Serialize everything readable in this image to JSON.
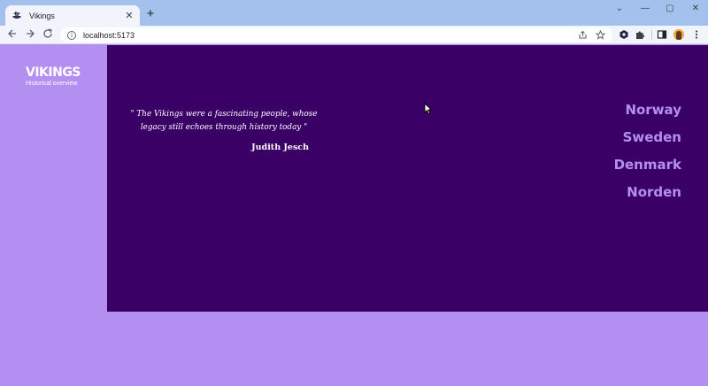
{
  "browser": {
    "tab_title": "Vikings",
    "url": "localhost:5173",
    "tab_close": "✕",
    "new_tab": "+",
    "window_controls": [
      "⌄",
      "—",
      "▢",
      "✕"
    ]
  },
  "page": {
    "logo_title": "VIKINGS",
    "logo_subtitle": "Historical overview",
    "quote": "\" The Vikings were a fascinating people, whose legacy still echoes through history today \"",
    "quote_author": "Judith Jesch",
    "nav_links": [
      "Norway",
      "Sweden",
      "Denmark",
      "Norden"
    ]
  },
  "icons": {
    "favicon": "viking-ship-icon",
    "back": "arrow-left-icon",
    "forward": "arrow-right-icon",
    "reload": "reload-icon",
    "share": "share-icon",
    "bookmark": "star-icon",
    "extensions": "puzzle-icon",
    "profile": "avatar"
  },
  "colors": {
    "page_background": "#b48ff2",
    "hero_background": "#3a0066",
    "nav_link": "#b48ff2"
  }
}
